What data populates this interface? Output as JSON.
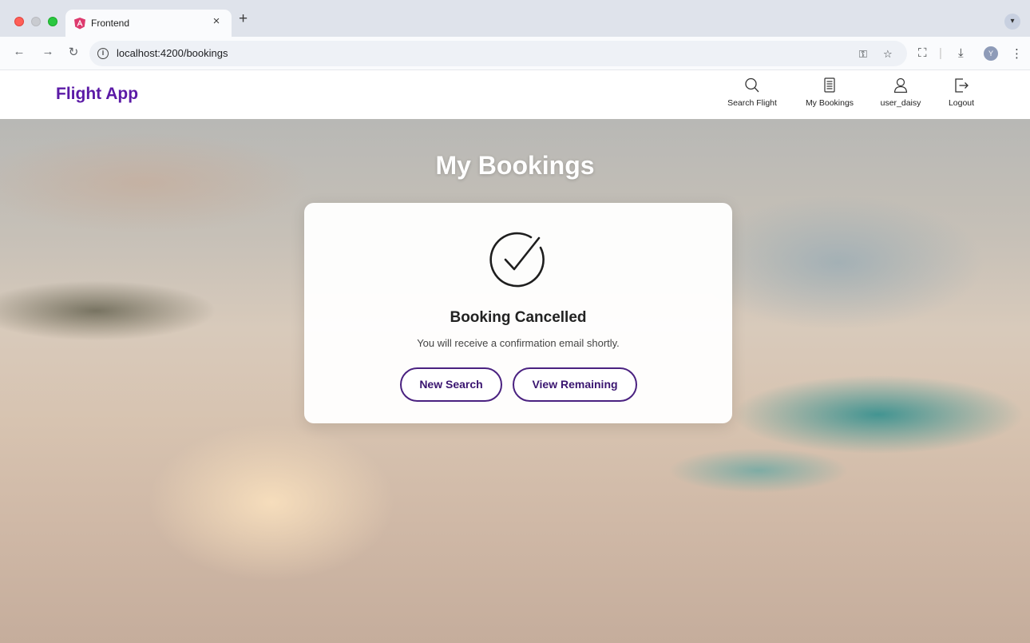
{
  "browser": {
    "tab_title": "Frontend",
    "tab_close": "×",
    "new_tab": "+",
    "url": "localhost:4200/bookings",
    "avatar_initial": "Y"
  },
  "app": {
    "brand": "Flight App",
    "nav": [
      {
        "label": "Search Flight",
        "icon": "search-icon"
      },
      {
        "label": "My Bookings",
        "icon": "list-icon"
      },
      {
        "label": "user_daisy",
        "icon": "user-icon"
      },
      {
        "label": "Logout",
        "icon": "logout-icon"
      }
    ]
  },
  "page": {
    "title": "My Bookings"
  },
  "card": {
    "icon": "check-circle-icon",
    "title": "Booking Cancelled",
    "message": "You will receive a confirmation email shortly.",
    "primary_button": "New Search",
    "secondary_button": "View Remaining"
  },
  "colors": {
    "brand": "#5b1aa6",
    "button_border": "#4a2180"
  }
}
